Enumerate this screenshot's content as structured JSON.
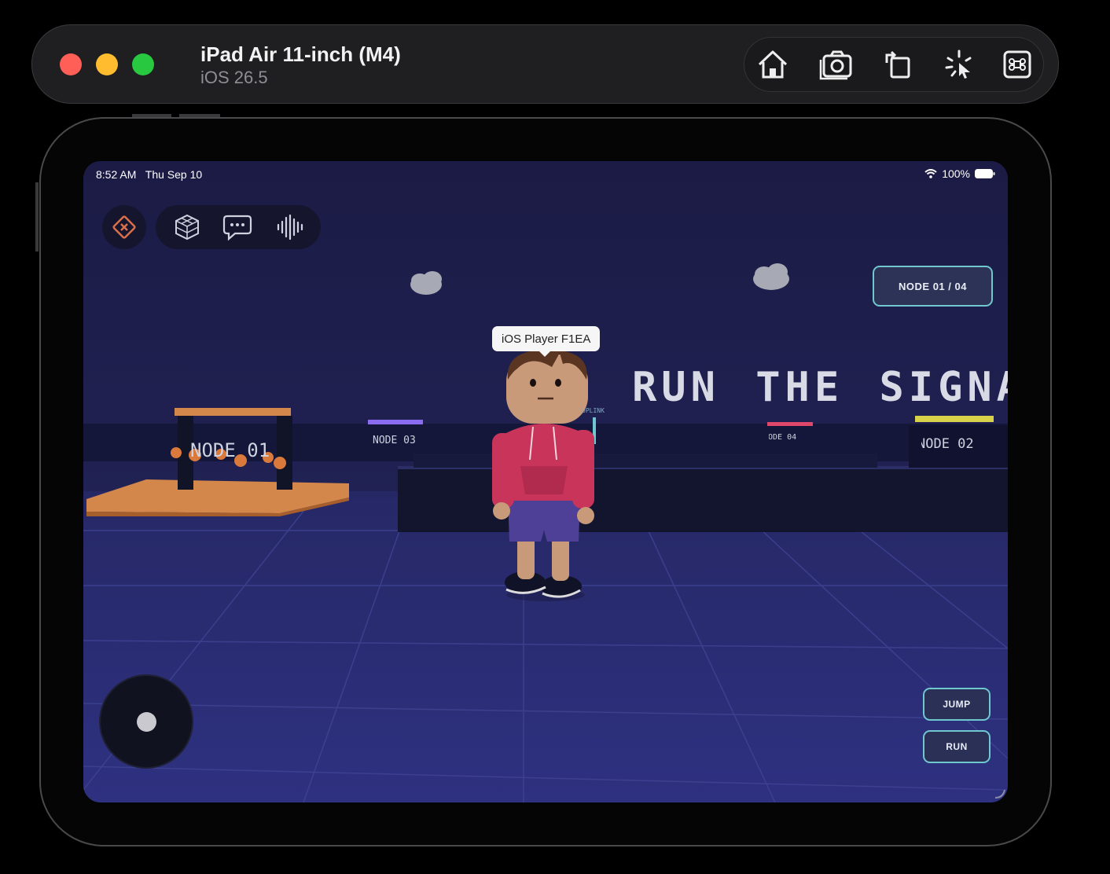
{
  "simulator": {
    "device_name": "iPad Air 11-inch (M4)",
    "os_version": "iOS 26.5",
    "toolbar": [
      "home-icon",
      "screenshot-icon",
      "rotate-icon",
      "touch-indicator-icon",
      "keyboard-shortcut-icon"
    ]
  },
  "status_bar": {
    "time": "8:52 AM",
    "date": "Thu Sep 10",
    "battery": "100%"
  },
  "hud": {
    "close_icon": "close-icon",
    "tools": [
      "cube-icon",
      "chat-icon",
      "voice-icon"
    ],
    "node_progress": "NODE 01 / 04",
    "player_name": "iOS Player F1EA",
    "jump_label": "JUMP",
    "run_label": "RUN"
  },
  "scene": {
    "sign": "RUN THE SIGNAL",
    "nodes": [
      "NODE 01",
      "NODE 03",
      "NODE 04",
      "NODE 02"
    ],
    "uplink": "UPLINK",
    "colors": {
      "sky": "#1c1c4a",
      "floor": "#2b2d72",
      "accent": "#6fc7cf",
      "orange": "#d4874a",
      "hoodie": "#c8345a"
    }
  }
}
